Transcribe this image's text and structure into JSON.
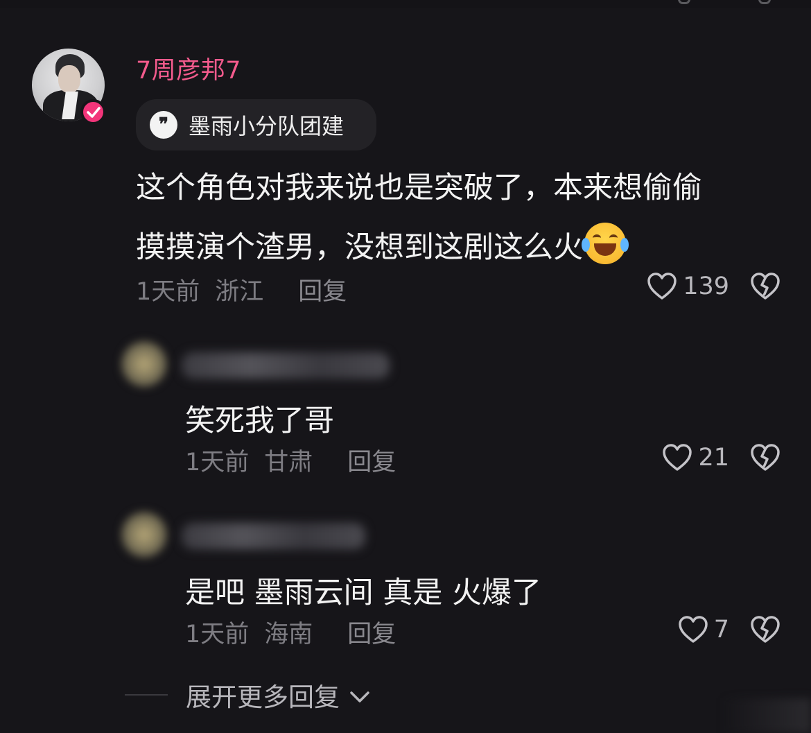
{
  "comment": {
    "username": "7周彦邦7",
    "tag": "墨雨小分队团建",
    "content_line1": "这个角色对我来说也是突破了，本来想偷偷",
    "content_line2": "摸摸演个渣男，没想到这剧这么火",
    "time": "1天前",
    "location": "浙江",
    "reply_label": "回复",
    "likes": "139",
    "icons": [
      "verified-badge-icon",
      "quote-bubble-icon",
      "laughing-tears-emoji",
      "heart-icon",
      "dislike-heart-icon"
    ]
  },
  "replies": [
    {
      "content": "笑死我了哥",
      "time": "1天前",
      "location": "甘肃",
      "reply_label": "回复",
      "likes": "21"
    },
    {
      "content": "是吧 墨雨云间 真是 火爆了",
      "time": "1天前",
      "location": "海南",
      "reply_label": "回复",
      "likes": "7"
    }
  ],
  "expand_more": "展开更多回复",
  "colors": {
    "background": "#161519",
    "username": "#f45b8d",
    "verified": "#f2357a",
    "meta_text": "#7e7d83",
    "body_text": "#f2f2f2"
  }
}
